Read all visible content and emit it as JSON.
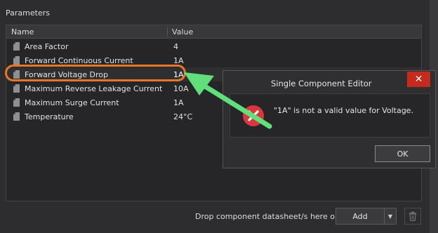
{
  "panel": {
    "title": "Parameters"
  },
  "grid": {
    "columns": [
      "Name",
      "Value"
    ],
    "rows": [
      {
        "name": "Area Factor",
        "value": "4"
      },
      {
        "name": "Forward Continuous Current",
        "value": "1A"
      },
      {
        "name": "Forward Voltage Drop",
        "value": "1A"
      },
      {
        "name": "Maximum Reverse Leakage Current",
        "value": "10A"
      },
      {
        "name": "Maximum Surge Current",
        "value": "1A"
      },
      {
        "name": "Temperature",
        "value": "24°C"
      }
    ],
    "selected_row": 2
  },
  "dialog": {
    "title": "Single Component Editor",
    "close_label": "✕",
    "message": "\"1A\" is not a valid value for Voltage.",
    "ok_label": "OK"
  },
  "footer": {
    "drop_label": "Drop component datasheet/s here or",
    "add_label": "Add",
    "dropdown_glyph": "▼"
  },
  "colors": {
    "highlight_ring": "#e8752a",
    "annotation_arrow": "#5fe07a",
    "error_icon": "#d9363e",
    "close_button": "#c42b1c"
  }
}
